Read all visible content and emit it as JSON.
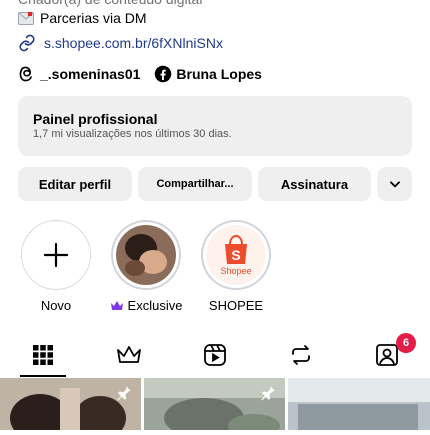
{
  "profile": {
    "role": "Criador(a) de conteúdo digital",
    "dm_text": "Parcerias via DM",
    "link": "s.shopee.com.br/6fXNlniSNx",
    "threads_handle": "_.someninas01",
    "facebook_name": "Bruna Lopes"
  },
  "panel": {
    "title": "Painel profissional",
    "subtitle": "1,7 mi visualizações nos últimos 30 dias."
  },
  "buttons": {
    "edit": "Editar perfil",
    "share": "Compartilhar...",
    "subscription": "Assinatura"
  },
  "highlights": [
    {
      "label": "Novo",
      "icon": "plus-icon"
    },
    {
      "label": "Exclusive",
      "icon": "crown-icon"
    },
    {
      "label": "SHOPEE",
      "icon": "shopee-logo",
      "logo_text": "Shopee"
    }
  ],
  "tabs": [
    {
      "name": "grid",
      "icon": "grid-icon",
      "active": true
    },
    {
      "name": "subscriptions",
      "icon": "crown-icon"
    },
    {
      "name": "reels",
      "icon": "reels-icon"
    },
    {
      "name": "reposts",
      "icon": "repost-icon"
    },
    {
      "name": "tagged",
      "icon": "tagged-icon",
      "badge": "6"
    }
  ],
  "colors": {
    "accent": "#7c3aed",
    "link": "#1f3a8a",
    "badge": "#e11d48",
    "shopee": "#ee4d2d"
  }
}
